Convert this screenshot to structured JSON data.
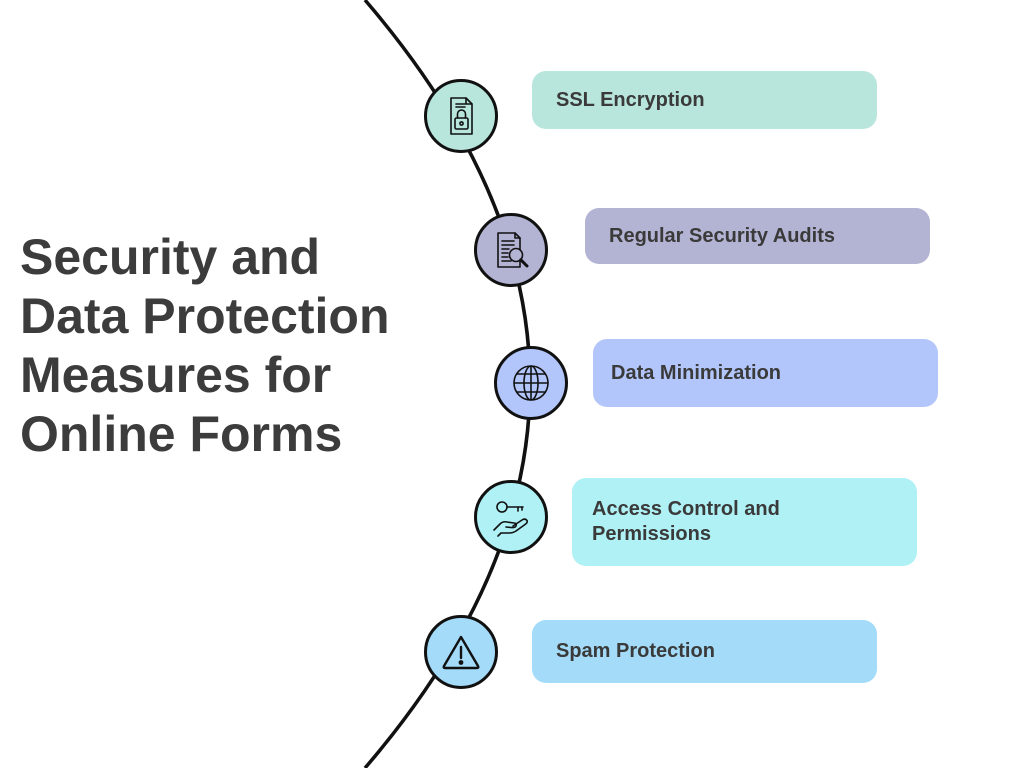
{
  "title_lines": [
    "Security and",
    "Data Protection",
    "Measures for",
    "Online Forms"
  ],
  "colors": {
    "mint": "#b8e6dc",
    "lavender": "#b3b3d3",
    "periwinkle": "#b3c6fb",
    "aqua": "#aff1f5",
    "sky": "#a3dbf9",
    "line": "#111111",
    "title": "#3c3c3c"
  },
  "measures": [
    {
      "label": "SSL Encryption",
      "icon": "document-lock-icon",
      "color": "#b8e6dc"
    },
    {
      "label": "Regular Security Audits",
      "icon": "document-search-icon",
      "color": "#b3b3d3"
    },
    {
      "label": "Data Minimization",
      "icon": "globe-icon",
      "color": "#b3c6fb"
    },
    {
      "label": "Access Control and Permissions",
      "icon": "key-hand-icon",
      "color": "#aff1f5"
    },
    {
      "label": "Spam Protection",
      "icon": "warning-icon",
      "color": "#a3dbf9"
    }
  ]
}
